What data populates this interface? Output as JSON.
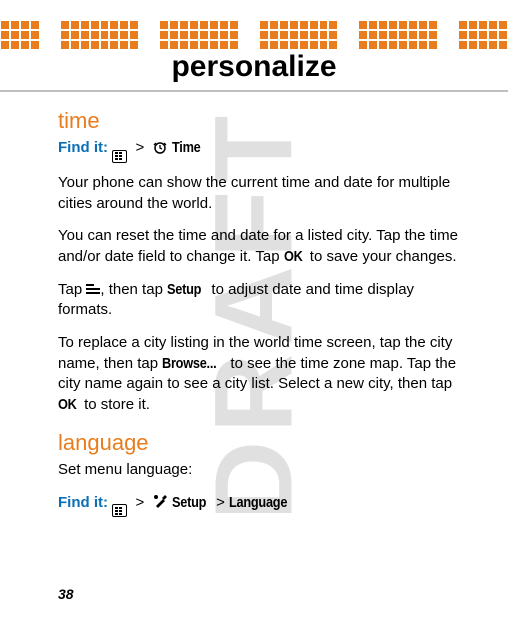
{
  "watermark": "DRAFT",
  "page_title": "personalize",
  "page_number": "38",
  "find_it_label": "Find it:",
  "gt": ">",
  "sections": {
    "time": {
      "heading": "time",
      "nav_label": "Time",
      "p1": "Your phone can show the current time and date for multiple cities around the world.",
      "p2a": "You can reset the time and date for a listed city. Tap the time and/or date field to change it. Tap ",
      "p2_ok": "OK",
      "p2b": " to save your changes.",
      "p3a": "Tap ",
      "p3b": ", then tap ",
      "p3_setup": "Setup",
      "p3c": " to adjust date and time display formats.",
      "p4a": "To replace a city listing in the world time screen, tap the city name, then tap ",
      "p4_browse": "Browse...",
      "p4b": " to see the time zone map. Tap the city name again to see a city list. Select a new city, then tap ",
      "p4_ok": "OK",
      "p4c": " to store it."
    },
    "language": {
      "heading": "language",
      "p1": "Set menu language:",
      "nav_setup": "Setup",
      "nav_lang": "Language"
    }
  }
}
